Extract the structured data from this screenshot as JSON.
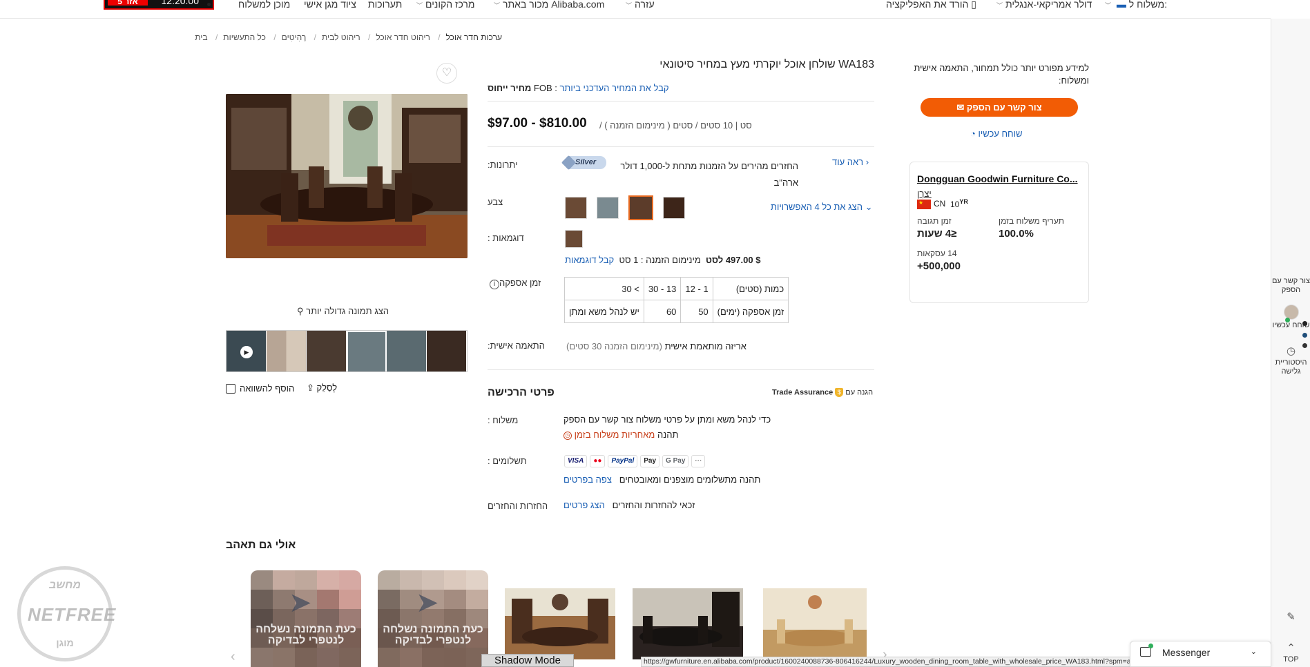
{
  "topnav": {
    "timer_time": "12:20:00",
    "timer_label": "5 אזר",
    "items": {
      "ship_to": "משלוח ל:",
      "currency": "דולר אמריקאי-אנגלית",
      "app": "הורד את האפליקציה",
      "help": "עזרה",
      "sell": "מכור באתר Alibaba.com",
      "buyer_center": "מרכז הקונים",
      "trade_shows": "תערוכות",
      "personal": "ציוד מגן אישי",
      "shipping": "מוכן למשלוח"
    }
  },
  "breadcrumb": [
    "בית",
    "כל התעשיות",
    "רָהִיטִים",
    "ריהוט לבית",
    "ריהוט חדר אוכל",
    "ערכות חדר אוכל"
  ],
  "gallery": {
    "zoom_label": "הצג תמונה גדולה יותר",
    "compare_label": "הוסף להשוואה",
    "share_label": "לְסַלֵק"
  },
  "product": {
    "title": "WA183 שולחן אוכל יוקרתי מעץ במחיר סיטונאי",
    "fob_label": "מחיר ייחוס",
    "fob_prefix": "FOB",
    "latest_price_link": "קבל את המחיר העדכני ביותר",
    "price_range": "$97.00 - $810.00",
    "moq_text": "סט | 10 סטים / סטים ( מינימום הזמנה ) /",
    "advantages_label": "יתרונות:",
    "silver_badge": "Silver",
    "advantages_text": "החזרים מהירים על הזמנות מתחת ל-1,000 דולר ארה\"ב",
    "see_more": "ראה עוד",
    "color_label": "צבע",
    "show_all_options": "הצג את כל 4 האפשרויות",
    "samples_label": "דוגמאות :",
    "sample_price": "$ 497.00 לסט",
    "sample_moq": "מינימום הזמנה : 1 סט",
    "get_samples": "קבל דוגמאות",
    "lead_time_label": "זמן אספקה",
    "lead_table": {
      "row1": [
        "כמות (סטים)",
        "1 - 12",
        "13 - 30",
        "> 30"
      ],
      "row2": [
        "זמן אספקה (ימים)",
        "50",
        "60",
        "יש לנהל משא ומתן"
      ]
    },
    "customization_label": "התאמה אישית:",
    "customization_text": "אריזה מותאמת אישית",
    "customization_moq": "(מינימום הזמנה 30 סטים)"
  },
  "purchase": {
    "title": "פרטי הרכישה",
    "trade_assurance": "Trade Assurance",
    "trade_assurance_prefix": "הגנה עם",
    "shipping_label": "משלוח :",
    "shipping_text": "כדי לנהל משא ומתן על פרטי משלוח",
    "contact_supplier": "צור קשר עם הספק",
    "shipping_guarantee_prefix": "תהנה",
    "shipping_guarantee": "מאחריות משלוח בזמן",
    "payments_label": "תשלומים :",
    "payment_methods": [
      "VISA",
      "●●",
      "PayPal",
      "Pay",
      "G Pay",
      "···"
    ],
    "payments_text": "תהנה מתשלומים מוצפנים ומאובטחים",
    "payments_details": "צפה בפרטים",
    "returns_label": "החזרות והחזרים",
    "returns_text": "זכאי להחזרות והחזרים",
    "returns_details": "הצג פרטים"
  },
  "rightcol": {
    "question": "למידע מפורט יותר כולל תמחור, התאמה אישית ומשלוח:",
    "contact_btn": "צור קשר עם הספק",
    "chat_now": "שוחח עכשיו",
    "supplier_name": "Dongguan Goodwin Furniture Co...",
    "supplier_type": "יַצרָן",
    "country": "CN",
    "years": "10",
    "years_suffix": "YR",
    "stat1_label": "תעריף משלוח בזמן",
    "stat1_value": "100.0%",
    "stat2_label": "זמן תגובה",
    "stat2_value": "≤4 שעות",
    "stat3_label": "14 עסקאות",
    "stat3_value": "500,000+"
  },
  "sidebar": {
    "contact": "צור קשר עם הספק",
    "chat": "שוחח עכשיו",
    "history": "היסטוריית גלישה",
    "top": "TOP"
  },
  "recommend": {
    "title": "אולי גם תאהב",
    "blocked_text": "כעת התמונה נשלחה לנטפרי לבדיקה"
  },
  "netfree": {
    "top": "מחשב",
    "mid": "NETFREE",
    "bottom": "מוגן"
  },
  "statusbar": {
    "shadow_mode": "Shadow Mode",
    "url": "https://gwfurniture.en.alibaba.com/product/1600240088736-806416244/Luxury_wooden_dining_room_table_with_wholesale_price_WA183.html?spm=a2700.details.0.0.4e903e41kfRDc",
    "messenger": "Messenger"
  },
  "colors": {
    "accent": "#f25c05",
    "link": "#1a5fb4"
  }
}
